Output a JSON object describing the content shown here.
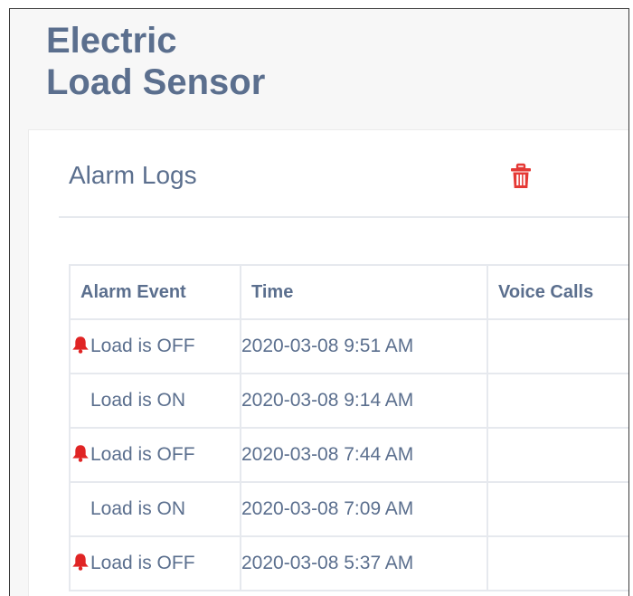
{
  "page": {
    "title_line1": "Electric",
    "title_line2": "Load Sensor"
  },
  "card": {
    "title": "Alarm Logs",
    "delete_icon": "trash-icon",
    "accent_color": "#e53935"
  },
  "table": {
    "columns": [
      "Alarm Event",
      "Time",
      "Voice Calls"
    ],
    "rows": [
      {
        "event": "Load is OFF",
        "alarm": true,
        "icon": "bell-icon",
        "time": "2020-03-08 9:51 AM",
        "voice_calls": ""
      },
      {
        "event": "Load is ON",
        "alarm": false,
        "icon": "",
        "time": "2020-03-08 9:14 AM",
        "voice_calls": ""
      },
      {
        "event": "Load is OFF",
        "alarm": true,
        "icon": "bell-icon",
        "time": "2020-03-08 7:44 AM",
        "voice_calls": ""
      },
      {
        "event": "Load is ON",
        "alarm": false,
        "icon": "",
        "time": "2020-03-08 7:09 AM",
        "voice_calls": ""
      },
      {
        "event": "Load is OFF",
        "alarm": true,
        "icon": "bell-icon",
        "time": "2020-03-08 5:37 AM",
        "voice_calls": ""
      }
    ]
  }
}
